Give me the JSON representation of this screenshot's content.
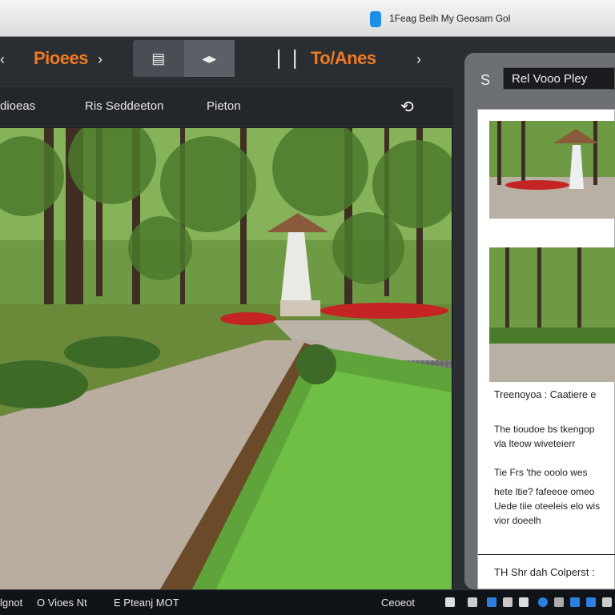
{
  "window": {
    "title": "1Feag Belh My Geosam Gol"
  },
  "topbar": {
    "nav_left": "Pioees",
    "nav_right": "To/Anes"
  },
  "subbar": {
    "items": [
      "dioeas",
      "Ris Seddeeton",
      "Pieton"
    ]
  },
  "right_panel": {
    "s_label": "S",
    "title": "Rel Vooo Pley",
    "caption1": "Treenoyoa : Caatiere e",
    "para1": [
      "The tioudoe bs tkengop",
      "vla lteow wiveteierr"
    ],
    "para2": [
      "Tie Frs 'the ooolo wes",
      "hete ltie? fafeeoe omeo",
      "Uede tiie oteeleis elo wis",
      "vior doeelh"
    ],
    "footer": "TH Shr dah Colperst :"
  },
  "taskbar": {
    "left1": "lgnot",
    "left2": "O Vioes Nt",
    "left3": "E  Pteanj MOT",
    "right": "Ceoeot"
  }
}
